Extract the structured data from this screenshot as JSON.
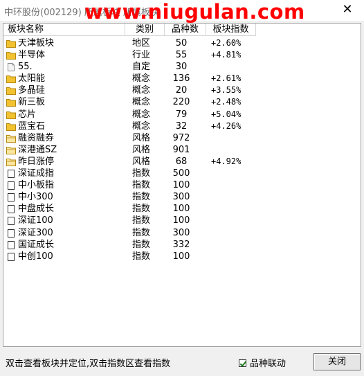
{
  "window": {
    "title": "中环股份(002129) 所属板块 所属板块",
    "watermark": "www.niugulan.com",
    "close_glyph": "✕"
  },
  "table": {
    "headers": [
      "板块名称",
      "类别",
      "品种数",
      "板块指数"
    ],
    "rows": [
      {
        "icon": "folder",
        "name": "天津板块",
        "type": "地区",
        "count": "50",
        "index": "+2.60%"
      },
      {
        "icon": "folder",
        "name": "半导体",
        "type": "行业",
        "count": "55",
        "index": "+4.81%"
      },
      {
        "icon": "doc",
        "name": "55.",
        "type": "自定",
        "count": "30",
        "index": ""
      },
      {
        "icon": "folder",
        "name": "太阳能",
        "type": "概念",
        "count": "136",
        "index": "+2.61%"
      },
      {
        "icon": "folder",
        "name": "多晶硅",
        "type": "概念",
        "count": "20",
        "index": "+3.55%"
      },
      {
        "icon": "folder",
        "name": "新三板",
        "type": "概念",
        "count": "220",
        "index": "+2.48%"
      },
      {
        "icon": "folder",
        "name": "芯片",
        "type": "概念",
        "count": "79",
        "index": "+5.04%"
      },
      {
        "icon": "folder",
        "name": "蓝宝石",
        "type": "概念",
        "count": "32",
        "index": "+4.26%"
      },
      {
        "icon": "folder-open",
        "name": "融资融券",
        "type": "风格",
        "count": "972",
        "index": ""
      },
      {
        "icon": "folder-open",
        "name": "深港通SZ",
        "type": "风格",
        "count": "901",
        "index": ""
      },
      {
        "icon": "folder-open",
        "name": "昨日涨停",
        "type": "风格",
        "count": "68",
        "index": "+4.92%"
      },
      {
        "icon": "page",
        "name": "深证成指",
        "type": "指数",
        "count": "500",
        "index": ""
      },
      {
        "icon": "page",
        "name": "中小板指",
        "type": "指数",
        "count": "100",
        "index": ""
      },
      {
        "icon": "page",
        "name": "中小300",
        "type": "指数",
        "count": "300",
        "index": ""
      },
      {
        "icon": "page",
        "name": "中盘成长",
        "type": "指数",
        "count": "100",
        "index": ""
      },
      {
        "icon": "page",
        "name": "深证100",
        "type": "指数",
        "count": "100",
        "index": ""
      },
      {
        "icon": "page",
        "name": "深证300",
        "type": "指数",
        "count": "300",
        "index": ""
      },
      {
        "icon": "page",
        "name": "国证成长",
        "type": "指数",
        "count": "332",
        "index": ""
      },
      {
        "icon": "page",
        "name": "中创100",
        "type": "指数",
        "count": "100",
        "index": ""
      }
    ]
  },
  "footer": {
    "hint": "双击查看板块并定位,双击指数区查看指数",
    "checkbox_label": "品种联动",
    "checkbox_checked": true,
    "close_label": "关闭"
  },
  "colors": {
    "watermark": "#ff0000",
    "folder": "#f2c230",
    "folder_outline": "#b68a10"
  }
}
